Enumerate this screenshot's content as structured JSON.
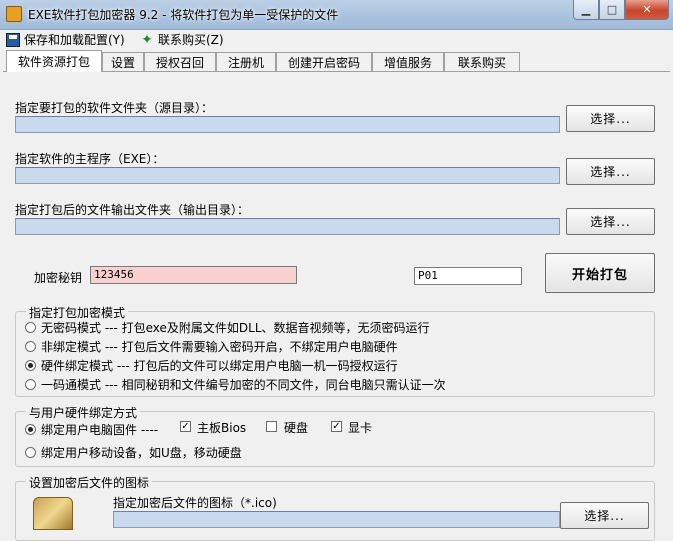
{
  "window": {
    "title": "EXE软件打包加密器 9.2 - 将软件打包为单一受保护的文件",
    "minimize_label": "▁",
    "maximize_label": "□",
    "close_label": "✕"
  },
  "menu": {
    "items": [
      {
        "label": "保存和加载配置(Y)",
        "icon": "save-icon"
      },
      {
        "label": "联系购买(Z)",
        "icon": "buy-icon"
      }
    ]
  },
  "tabs": [
    "软件资源打包",
    "设置",
    "授权召回",
    "注册机",
    "创建开启密码",
    "增值服务",
    "联系购买"
  ],
  "active_tab": "软件资源打包",
  "source": {
    "folder_label": "指定要打包的软件文件夹（源目录）：",
    "folder_value": "",
    "main_label": "指定软件的主程序（EXE）：",
    "main_value": "",
    "output_label": "指定打包后的文件输出文件夹（输出目录）：",
    "output_value": "",
    "browse_label": "选择..."
  },
  "encrypt": {
    "key_label": "加密秘钥",
    "key_value": "123456",
    "code_value": "P01",
    "start_label": "开始打包"
  },
  "mode_group": {
    "title": "指定打包加密模式",
    "options": [
      {
        "label": "无密码模式 --- 打包exe及附属文件如DLL、数据音视频等，无须密码运行",
        "selected": false
      },
      {
        "label": "非绑定模式 --- 打包后文件需要输入密码开启，不绑定用户电脑硬件",
        "selected": false
      },
      {
        "label": "硬件绑定模式 --- 打包后的文件可以绑定用户电脑一机一码授权运行",
        "selected": true
      },
      {
        "label": "一码通模式 --- 相同秘钥和文件编号加密的不同文件，同台电脑只需认证一次",
        "selected": false
      }
    ]
  },
  "bind_group": {
    "title": "与用户硬件绑定方式",
    "option1_label": "绑定用户电脑固件 ----",
    "option1_selected": true,
    "checks": [
      {
        "label": "主板Bios",
        "checked": true
      },
      {
        "label": "硬盘",
        "checked": false
      },
      {
        "label": "显卡",
        "checked": true
      }
    ],
    "option2_label": "绑定用户移动设备，如U盘，移动硬盘",
    "option2_selected": false
  },
  "icon_group": {
    "title": "设置加密后文件的图标",
    "field_label": "指定加密后文件的图标（*.ico)",
    "field_value": "",
    "browse_label": "选择..."
  }
}
